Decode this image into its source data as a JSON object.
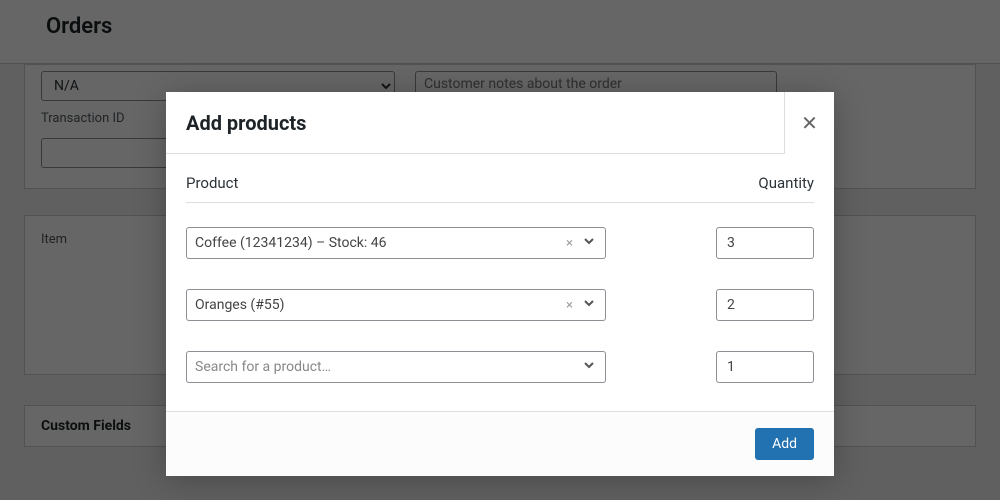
{
  "page": {
    "title": "Orders",
    "payment_method_value": "N/A",
    "transaction_id_label": "Transaction ID",
    "transaction_id_value": "",
    "customer_note_placeholder": "Customer notes about the order",
    "item_header": "Item",
    "custom_fields_title": "Custom Fields"
  },
  "modal": {
    "title": "Add products",
    "columns": {
      "product": "Product",
      "quantity": "Quantity"
    },
    "rows": [
      {
        "product": "Coffee (12341234) – Stock: 46",
        "qty": "3",
        "clearable": true
      },
      {
        "product": "Oranges (#55)",
        "qty": "2",
        "clearable": true
      },
      {
        "product": "",
        "qty": "1",
        "clearable": false
      }
    ],
    "search_placeholder": "Search for a product…",
    "add_button": "Add"
  }
}
